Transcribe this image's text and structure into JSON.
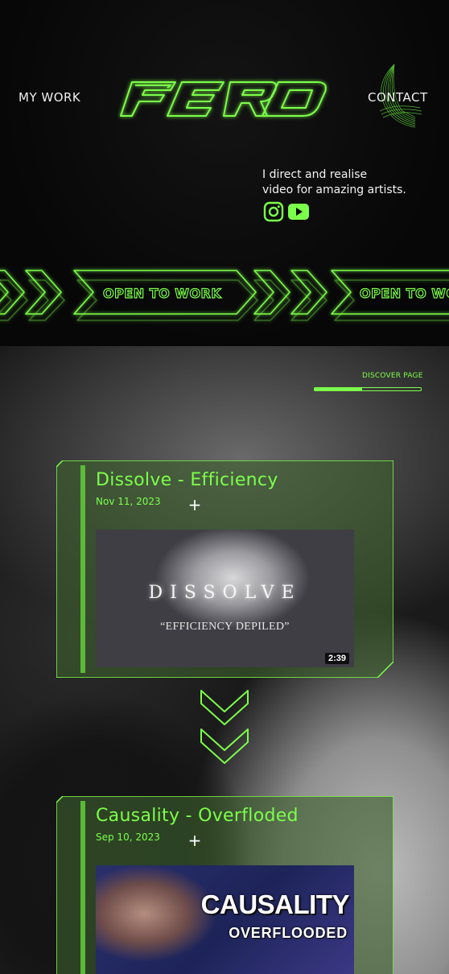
{
  "nav": {
    "work_label": "MY WORK",
    "contact_label": "CONTACT",
    "logo_text": "FERD"
  },
  "hero": {
    "tagline_line1": "I direct and realise",
    "tagline_line2": "video for amazing artists.",
    "social": [
      {
        "name": "instagram-icon"
      },
      {
        "name": "youtube-icon"
      }
    ]
  },
  "banner": {
    "label": "OPEN TO WORK"
  },
  "discover": {
    "label": "DISCOVER PAGE",
    "progress": 0.45
  },
  "videos": [
    {
      "title": "Dissolve - Efficiency",
      "date": "Nov 11, 2023",
      "thumb_title": "DISSOLVE",
      "thumb_subtitle": "“EFFICIENCY DEPILED”",
      "duration": "2:39"
    },
    {
      "title": "Causality - Overfloded",
      "date": "Sep 10, 2023",
      "thumb_title": "CAUSALITY",
      "thumb_subtitle": "OVERFLOODED"
    }
  ],
  "colors": {
    "accent": "#7cff4a",
    "background": "#050605"
  }
}
